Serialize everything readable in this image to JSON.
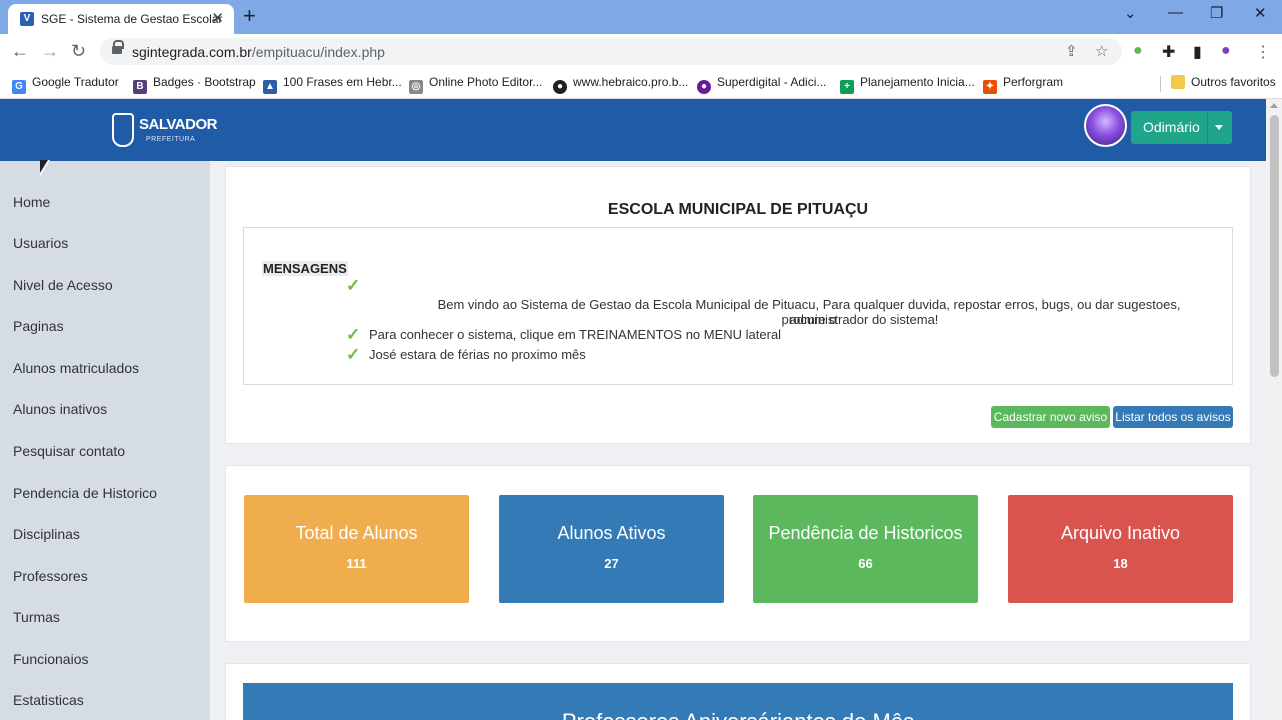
{
  "browser": {
    "tab_title": "SGE - Sistema de Gestao Escolar",
    "url_domain": "sgintegrada.com.br",
    "url_path": "/empituacu/index.php",
    "bookmarks": [
      {
        "label": "Google Tradutor",
        "icon": "translate-icon",
        "color": "#4285f4",
        "glyph": "G"
      },
      {
        "label": "Badges · Bootstrap",
        "icon": "bootstrap-icon",
        "color": "#563d7c",
        "glyph": "B"
      },
      {
        "label": "100 Frases em Hebr...",
        "icon": "image-icon",
        "color": "#2a5fa8",
        "glyph": "▲"
      },
      {
        "label": "Online Photo Editor...",
        "icon": "photo-editor-icon",
        "color": "#888888",
        "glyph": "◎"
      },
      {
        "label": "www.hebraico.pro.b...",
        "icon": "globe-icon",
        "color": "#202124",
        "glyph": "●"
      },
      {
        "label": "Superdigital - Adici...",
        "icon": "superdigital-icon",
        "color": "#6a1b9a",
        "glyph": "●"
      },
      {
        "label": "Planejamento Inicia...",
        "icon": "sheets-icon",
        "color": "#0f9d58",
        "glyph": "+"
      },
      {
        "label": "Perforgram",
        "icon": "perforgram-icon",
        "color": "#e65100",
        "glyph": "✦"
      }
    ],
    "other_bookmarks": "Outros favoritos"
  },
  "header": {
    "logo_text": "SALVADOR",
    "logo_sub": "PREFEITURA",
    "user_name": "Odimário",
    "accent": "#1f5ba6",
    "user_button_color": "#1fa58a"
  },
  "sidebar": {
    "items": [
      "Home",
      "Usuarios",
      "Nivel de Acesso",
      "Paginas",
      "Alunos matriculados",
      "Alunos inativos",
      "Pesquisar contato",
      "Pendencia de Historico",
      "Disciplinas",
      "Professores",
      "Turmas",
      "Funcionaios",
      "Estatisticas"
    ]
  },
  "main": {
    "school_name": "ESCOLA MUNICIPAL DE PITUAÇU",
    "messages_heading": "MENSAGENS",
    "messages": [
      "Bem vindo ao Sistema de Gestao da Escola Municipal de Pituacu, Para qualquer duvida, repostar erros, bugs, ou dar sugestoes, procure o",
      "administrador do sistema!",
      "Para conhecer o sistema, clique em TREINAMENTOS no MENU lateral",
      "José estara de férias no proximo mês"
    ],
    "btn_new_notice": "Cadastrar novo aviso",
    "btn_list_notices": "Listar todos os avisos",
    "stats": [
      {
        "title": "Total de Alunos",
        "value": "111",
        "color": "#f0ad4e"
      },
      {
        "title": "Alunos Ativos",
        "value": "27",
        "color": "#337ab7"
      },
      {
        "title": "Pendência de Historicos",
        "value": "66",
        "color": "#5cb85c"
      },
      {
        "title": "Arquivo Inativo",
        "value": "18",
        "color": "#d9534f"
      }
    ],
    "birthday_title": "Professores Aniversáriantes do Mês"
  }
}
